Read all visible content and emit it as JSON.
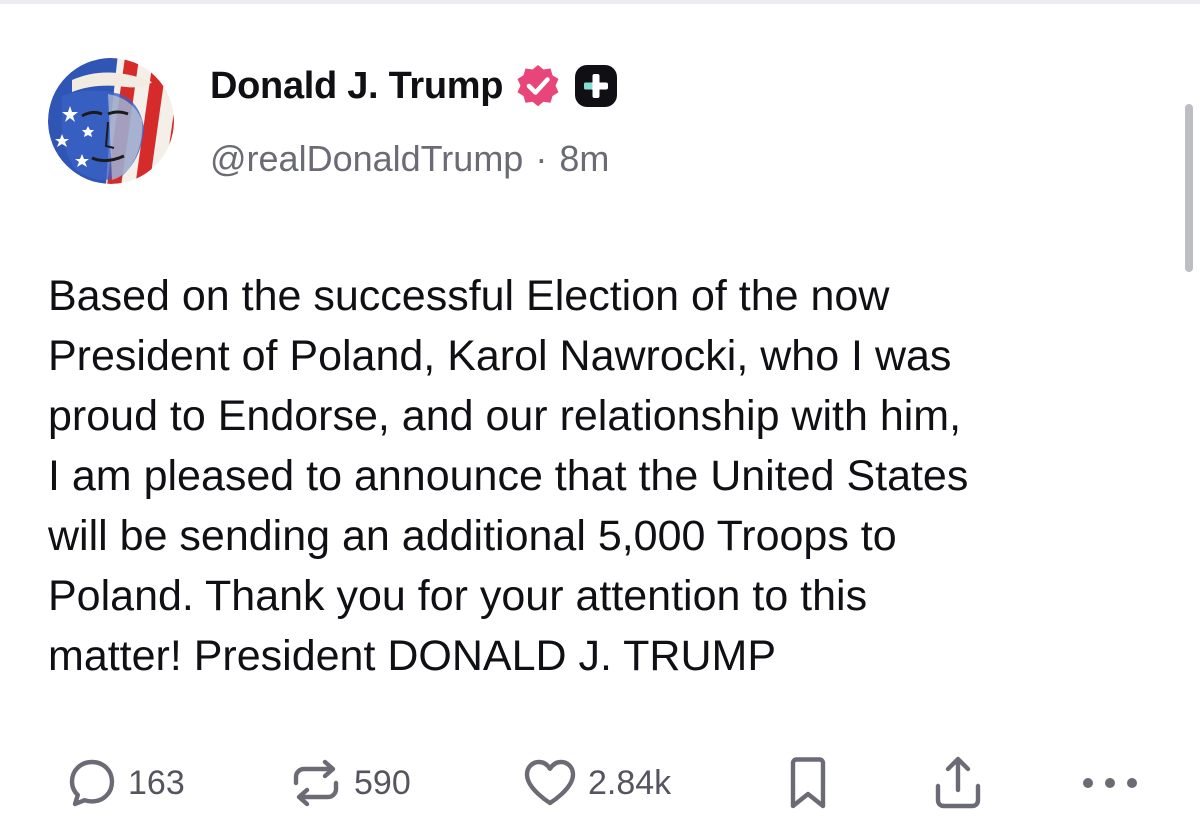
{
  "author": {
    "display_name": "Donald J. Trump",
    "handle": "@realDonaldTrump",
    "separator": "·",
    "time_ago": "8m",
    "verified_badge_icon": "verified-badge-icon",
    "verified_color": "#e8457b",
    "plus_badge_icon": "plus-badge-icon"
  },
  "post": {
    "lines": [
      "Based on the successful Election of the now",
      "President of Poland, Karol Nawrocki, who I was",
      "proud to Endorse, and our relationship with him,",
      "I am pleased to announce that the United States",
      "will be sending an additional 5,000 Troops to",
      "Poland. Thank you for your attention to this",
      "matter! President DONALD J. TRUMP"
    ]
  },
  "actions": {
    "reply": {
      "icon": "reply-icon",
      "count": "163"
    },
    "retruth": {
      "icon": "retruth-icon",
      "count": "590"
    },
    "like": {
      "icon": "heart-icon",
      "count": "2.84k"
    },
    "bookmark": {
      "icon": "bookmark-icon"
    },
    "share": {
      "icon": "share-icon"
    },
    "more": {
      "icon": "more-icon"
    }
  },
  "colors": {
    "text": "#101014",
    "muted": "#6b6b76",
    "accent": "#e8457b"
  }
}
